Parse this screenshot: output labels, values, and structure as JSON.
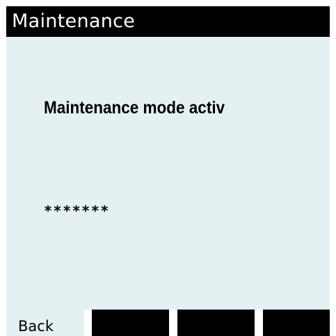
{
  "header": {
    "title": "Maintenance"
  },
  "main": {
    "status_message": "Maintenance mode activ",
    "masked_value": "*******"
  },
  "softkeys": {
    "items": [
      {
        "label": "Back"
      },
      {
        "label": ""
      },
      {
        "label": ""
      },
      {
        "label": ""
      }
    ]
  },
  "colors": {
    "title_bar": "#000000",
    "title_text": "#ffffff",
    "content_background": "#e4f0f2",
    "softkey_blank": "#000000"
  }
}
